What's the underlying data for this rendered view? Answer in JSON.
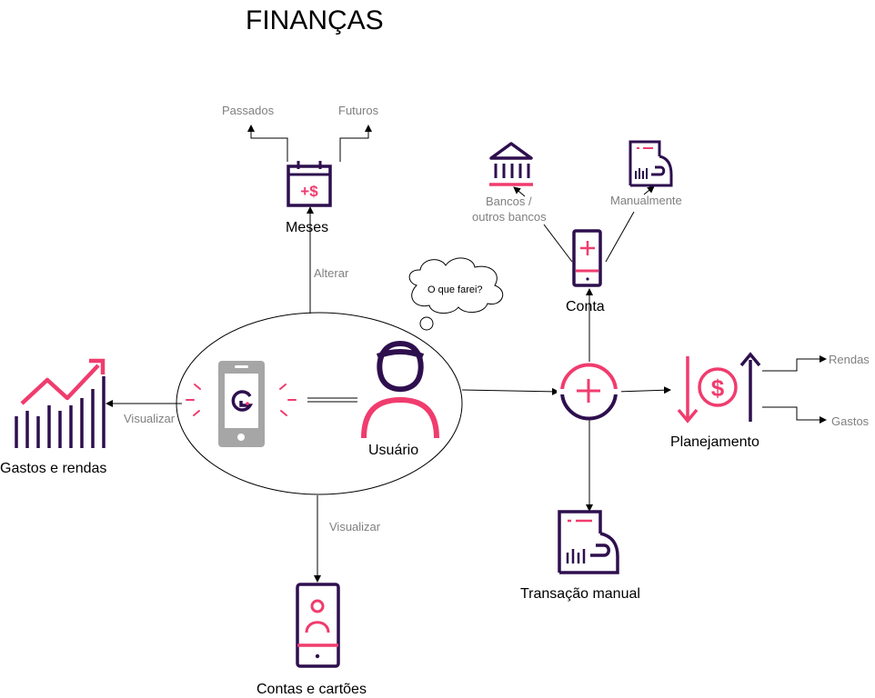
{
  "title": "FINANÇAS",
  "nodes": {
    "usuario": "Usuário",
    "meses": "Meses",
    "conta": "Conta",
    "planejamento": "Planejamento",
    "transacao_manual": "Transação manual",
    "gastos_rendas": "Gastos e rendas",
    "contas_cartoes": "Contas e cartões"
  },
  "thought": "O que farei?",
  "edges": {
    "passados": "Passados",
    "futuros": "Futuros",
    "alterar": "Alterar",
    "bancos_1": "Bancos /",
    "bancos_2": "outros bancos",
    "manualmente": "Manualmente",
    "rendas": "Rendas",
    "gastos": "Gastos",
    "visualizar_left": "Visualizar",
    "visualizar_down": "Visualizar"
  },
  "colors": {
    "purple": "#2e0f4e",
    "pink": "#f03c6e",
    "gray": "#a6a6a6",
    "line": "#000000"
  },
  "icons": [
    "calendar-dollar-icon",
    "bank-icon",
    "receipt-hand-icon",
    "mobile-plus-icon",
    "plus-circle-icon",
    "dollar-updown-icon",
    "rising-bars-icon",
    "app-phone-icon",
    "user-icon",
    "mobile-profile-icon"
  ]
}
